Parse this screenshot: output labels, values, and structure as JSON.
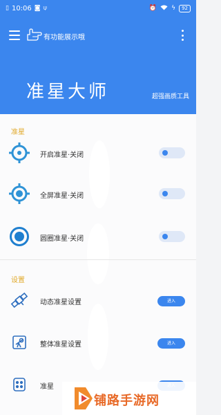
{
  "status_bar": {
    "time": "10:06",
    "battery": "92"
  },
  "toolbar": {
    "title": "有功能展示哦"
  },
  "header": {
    "app_title": "准星大师",
    "subtitle": "超强画质工具"
  },
  "sections": {
    "crosshair": {
      "label": "准星",
      "items": [
        {
          "label": "开启准星·关闭",
          "icon": "crosshair-ring-icon"
        },
        {
          "label": "全屏准星·关闭",
          "icon": "crosshair-dot-icon"
        },
        {
          "label": "圆圈准星·关闭",
          "icon": "circle-target-icon"
        }
      ]
    },
    "settings": {
      "label": "设置",
      "items": [
        {
          "label": "动态准星设置",
          "button": "进入",
          "icon": "satellite-icon"
        },
        {
          "label": "整体准星设置",
          "button": "进入",
          "icon": "telescope-icon"
        },
        {
          "label": "准星",
          "button": "进入",
          "icon": "gamepad-icon"
        }
      ]
    }
  },
  "watermark": {
    "text": "铺路手游网"
  },
  "colors": {
    "primary": "#3b86ee",
    "section_label": "#e0a92a",
    "watermark": "#e86a28"
  }
}
